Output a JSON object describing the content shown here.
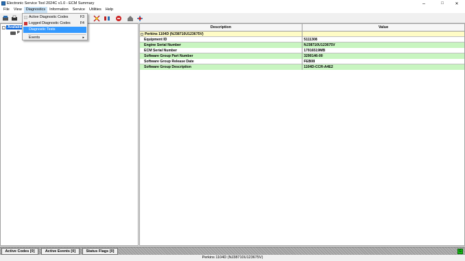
{
  "window": {
    "title": "Electronic Service Tool 2024C v1.0 - ECM Summary",
    "minimize": "–",
    "maximize": "□",
    "close": "✕"
  },
  "menu": [
    "File",
    "View",
    "Diagnostics",
    "Information",
    "Service",
    "Utilities",
    "Help"
  ],
  "dropdown": {
    "items": [
      {
        "label": "Active Diagnostic Codes",
        "shortcut": "F3",
        "icon": "active-codes-icon"
      },
      {
        "label": "Logged Diagnostic Codes",
        "shortcut": "F4",
        "icon": "logged-codes-icon"
      },
      {
        "label": "Diagnostic Tests",
        "shortcut": "",
        "icon": ""
      },
      {
        "label": "Events",
        "shortcut": "",
        "icon": ""
      }
    ]
  },
  "tree": {
    "root": "Available",
    "child": "P"
  },
  "grid": {
    "col_desc": "Description",
    "col_val": "Value",
    "header_row": "Perkins 1104D (NJ38710U123675V)",
    "rows": [
      {
        "desc": "Equipment ID",
        "value": "5111308"
      },
      {
        "desc": "Engine Serial Number",
        "value": "NJ38710U123675V"
      },
      {
        "desc": "ECM Serial Number",
        "value": "17916519MB"
      },
      {
        "desc": "Software Group Part Number",
        "value": "3290146-00"
      },
      {
        "desc": "Software Group Release Date",
        "value": "FEB08"
      },
      {
        "desc": "Software Group Description",
        "value": "1104D-CCR-A4E2"
      }
    ]
  },
  "status": {
    "active_codes": "Active Codes [0]",
    "active_events": "Active Events [0]",
    "status_flags": "Status Flags [0]",
    "indicator": "G"
  },
  "bottom": "Perkins 1104D (NJ38710U123675V)"
}
